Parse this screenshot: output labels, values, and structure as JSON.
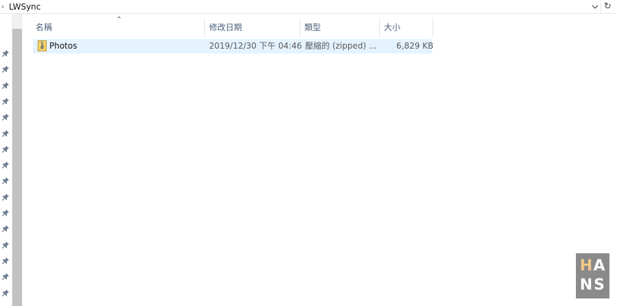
{
  "address_bar": {
    "path": "LWSync",
    "chevron_icon": "chevron-right-icon",
    "dropdown_icon": "chevron-down-icon",
    "refresh_icon": "refresh-icon"
  },
  "nav_pane": {
    "pin_icon": "pin-icon",
    "pin_count": 16
  },
  "columns": [
    {
      "key": "name",
      "label": "名稱",
      "sorted": "ascending"
    },
    {
      "key": "modified",
      "label": "修改日期"
    },
    {
      "key": "type",
      "label": "類型"
    },
    {
      "key": "size",
      "label": "大小"
    }
  ],
  "files": [
    {
      "name": "Photos",
      "modified": "2019/12/30 下午 04:46",
      "type": "壓縮的 (zipped) ...",
      "size": "6,829 KB",
      "icon": "zip-folder-icon",
      "selected": true
    }
  ],
  "watermark": {
    "letters": [
      "H",
      "A",
      "N",
      "S"
    ],
    "accent_color": "#f2c98a",
    "text_color": "#ffffff",
    "background": "#8a8a8a"
  },
  "colors": {
    "selection": "#e5f3ff",
    "header_text": "#4c607a",
    "scroll_thumb": "#c2c2c2"
  }
}
